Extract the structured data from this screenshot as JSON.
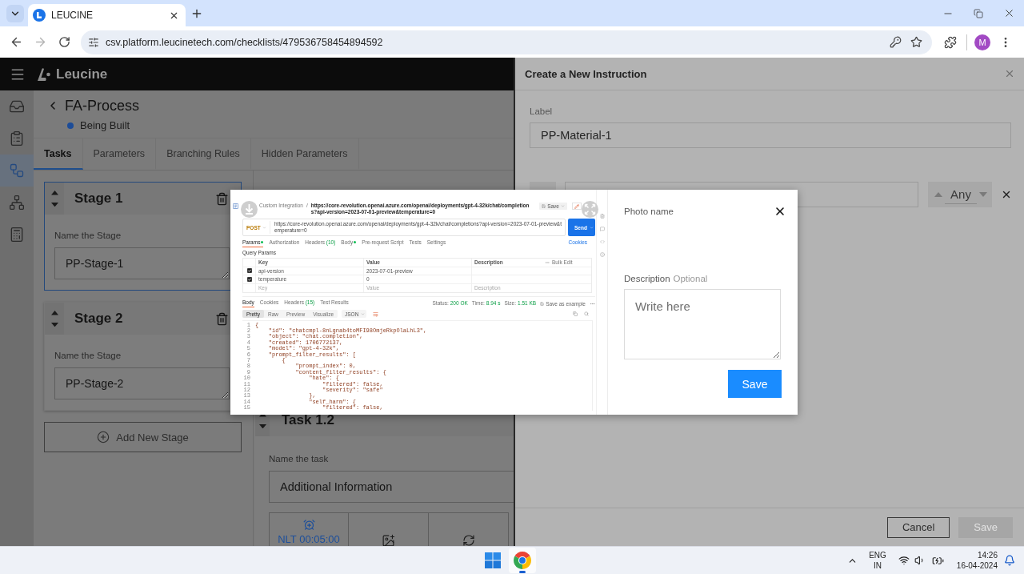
{
  "browser": {
    "tab_title": "LEUCINE",
    "can_go_forward": false,
    "url": "csv.platform.leucinetech.com/checklists/479536758454894592",
    "profile_initial": "M"
  },
  "app": {
    "brand": "Leucine",
    "sidebar": [
      {
        "selected": false
      },
      {
        "selected": false
      },
      {
        "selected": true
      },
      {
        "selected": false
      },
      {
        "selected": false
      }
    ],
    "process": {
      "title": "FA-Process",
      "status": "Being Built"
    },
    "tabs": [
      {
        "label": "Tasks",
        "selected": true
      },
      {
        "label": "Parameters",
        "selected": false
      },
      {
        "label": "Branching Rules",
        "selected": false
      },
      {
        "label": "Hidden Parameters",
        "selected": false
      }
    ],
    "stages": [
      {
        "title": "Stage 1",
        "field_label": "Name the Stage",
        "value": "PP-Stage-1",
        "selected": true
      },
      {
        "title": "Stage 2",
        "field_label": "Name the Stage",
        "value": "PP-Stage-2",
        "selected": false
      }
    ],
    "add_stage": "Add New Stage",
    "task": {
      "title": "Task 1.2",
      "field_label": "Name the task",
      "value": "Additional Information",
      "timer": "NLT 00:05:00"
    }
  },
  "drawer": {
    "title": "Create a New Instruction",
    "label_caption": "Label",
    "label_value": "PP-Material-1",
    "spinner_value": "Any",
    "buttons": [
      {
        "label": "Cancel",
        "disabled": false
      },
      {
        "label": "Save",
        "disabled": true
      }
    ]
  },
  "photo_dialog": {
    "preview": {
      "breadcrumb_parent": "Custom Integration",
      "breadcrumb_separator": "/",
      "request_title": "https://core-revolution.openai.azure.com/openai/deployments/gpt-4-32k/chat/completions?api-version=2023-07-01-preview&temperature=0",
      "save": "Save",
      "method": "POST",
      "url": "https://core-revolution.openai.azure.com/openai/deployments/gpt-4-32k/chat/completions?api-version=2023-07-01-preview&temperature=0",
      "send": "Send",
      "cookies": "Cookies",
      "request_tabs": [
        {
          "label": "Params",
          "dot": true,
          "selected": true
        },
        {
          "label": "Authorization",
          "dot": false,
          "selected": false
        },
        {
          "label": "Headers",
          "count": "(10)",
          "dot": false,
          "selected": false
        },
        {
          "label": "Body",
          "dot": true,
          "selected": false
        },
        {
          "label": "Pre-request Script",
          "dot": false,
          "selected": false
        },
        {
          "label": "Tests",
          "dot": false,
          "selected": false
        },
        {
          "label": "Settings",
          "dot": false,
          "selected": false
        }
      ],
      "query_params_title": "Query Params",
      "columns": [
        "Key",
        "Value",
        "Description"
      ],
      "bulk_edit": "Bulk Edit",
      "params": [
        {
          "key": "api-version",
          "value": "2023-07-01-preview",
          "checked": true
        },
        {
          "key": "temperature",
          "value": "0",
          "checked": true
        }
      ],
      "new_param": {
        "key": "Key",
        "value": "Value",
        "description": "Description"
      },
      "response_tabs": [
        {
          "label": "Body",
          "selected": true
        },
        {
          "label": "Cookies",
          "selected": false
        },
        {
          "label": "Headers",
          "count": "(15)",
          "selected": false
        },
        {
          "label": "Test Results",
          "selected": false
        }
      ],
      "stats": [
        {
          "label": "Status:",
          "value": "200 OK"
        },
        {
          "label": "Time:",
          "value": "8.94 s"
        },
        {
          "label": "Size:",
          "value": "1.51 KB"
        }
      ],
      "save_example": "Save as example",
      "view_modes": [
        {
          "label": "Pretty",
          "selected": true
        },
        {
          "label": "Raw",
          "selected": false
        },
        {
          "label": "Preview",
          "selected": false
        },
        {
          "label": "Visualize",
          "selected": false
        }
      ],
      "format": "JSON",
      "code": [
        {
          "number": "1",
          "text": "{"
        },
        {
          "number": "2",
          "text": "    \"id\": \"chatcmpl-8nLgnab4toMFI98OmjeRkpOlaLhL3\","
        },
        {
          "number": "3",
          "text": "    \"object\": \"chat.completion\","
        },
        {
          "number": "4",
          "text": "    \"created\": 1706772137,"
        },
        {
          "number": "5",
          "text": "    \"model\": \"gpt-4-32k\","
        },
        {
          "number": "6",
          "text": "    \"prompt_filter_results\": ["
        },
        {
          "number": "7",
          "text": "        {"
        },
        {
          "number": "8",
          "text": "            \"prompt_index\": 0,"
        },
        {
          "number": "9",
          "text": "            \"content_filter_results\": {"
        },
        {
          "number": "10",
          "text": "                \"hate\": {"
        },
        {
          "number": "11",
          "text": "                    \"filtered\": false,"
        },
        {
          "number": "12",
          "text": "                    \"severity\": \"safe\""
        },
        {
          "number": "13",
          "text": "                },"
        },
        {
          "number": "14",
          "text": "                \"self_harm\": {"
        },
        {
          "number": "15",
          "text": "                    \"filtered\": false,"
        }
      ]
    },
    "photo_name_label": "Photo name",
    "description_label": "Description",
    "description_hint": "Optional",
    "description_placeholder": "Write here",
    "save": "Save"
  },
  "taskbar": {
    "language": "ENG",
    "region": "IN",
    "time": "14:26",
    "date": "16-04-2024"
  }
}
